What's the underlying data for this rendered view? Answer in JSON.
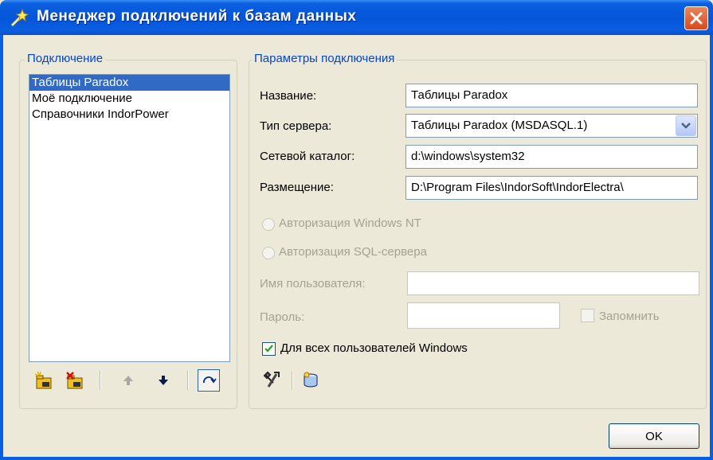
{
  "window": {
    "title": "Менеджер подключений к базам данных"
  },
  "connections": {
    "legend": "Подключение",
    "items": [
      {
        "label": "Таблицы Paradox",
        "selected": true
      },
      {
        "label": "Моё подключение",
        "selected": false
      },
      {
        "label": "Справочники IndorPower",
        "selected": false
      }
    ],
    "toolbar": [
      "new-connection-icon",
      "delete-connection-icon",
      "move-up-icon",
      "move-down-icon",
      "refresh-icon"
    ]
  },
  "params": {
    "legend": "Параметры подключения",
    "name_label": "Название:",
    "name_value": "Таблицы Paradox",
    "server_type_label": "Тип сервера:",
    "server_type_value": "Таблицы Paradox (MSDASQL.1)",
    "network_dir_label": "Сетевой каталог:",
    "network_dir_value": "d:\\windows\\system32",
    "location_label": "Размещение:",
    "location_value": "D:\\Program Files\\IndorSoft\\IndorElectra\\",
    "auth_windows_label": "Авторизация Windows NT",
    "auth_sql_label": "Авторизация SQL-сервера",
    "username_label": "Имя пользователя:",
    "username_value": "",
    "password_label": "Пароль:",
    "password_value": "",
    "remember_label": "Запомнить",
    "remember_checked": false,
    "all_users_label": "Для всех пользователей Windows",
    "all_users_checked": true,
    "tools": [
      "test-connection-icon",
      "database-icon"
    ]
  },
  "buttons": {
    "ok_label": "OK"
  }
}
